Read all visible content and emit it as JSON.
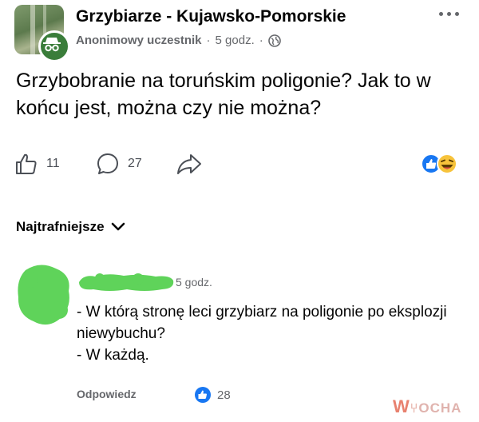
{
  "header": {
    "group_name": "Grzybiarze - Kujawsko-Pomorskie",
    "author": "Anonimowy uczestnik",
    "separator": "·",
    "time": "5 godz.",
    "separator2": "·"
  },
  "post": {
    "text": "Grzybobranie na toruńskim poligonie? Jak to w końcu jest, można czy nie można?"
  },
  "actions": {
    "like_count": "11",
    "comment_count": "27"
  },
  "sort": {
    "label": "Najtrafniejsze"
  },
  "comment": {
    "time": "5 godz.",
    "line1": "- W którą stronę leci grzybiarz na poligonie po eksplozji niewybuchu?",
    "line2": "- W każdą.",
    "reply_label": "Odpowiedz",
    "like_count": "28"
  },
  "watermark": {
    "w": "W",
    "rest": "OCHA"
  },
  "colors": {
    "censor_green": "#5fd35a",
    "fb_blue": "#1877f2",
    "meta_gray": "#65676b"
  }
}
